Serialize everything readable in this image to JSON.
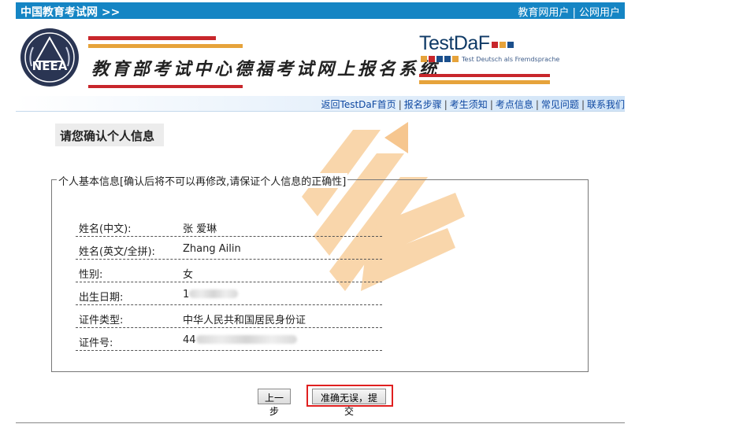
{
  "topbar": {
    "site_name": "中国教育考试网 >>",
    "users": [
      "教育网用户",
      "公网用户"
    ],
    "separator": " | ",
    "color": "#1585c4"
  },
  "header": {
    "logo_text": "NEEA",
    "system_title": "教育部考试中心德福考试网上报名系统",
    "brand": "TestDaF",
    "brand_tagline": "Test Deutsch als Fremdsprache",
    "brand_square_colors": [
      "#c8262b",
      "#e6a33b",
      "#1b4f8c",
      "#c8262b"
    ]
  },
  "nav": {
    "links": [
      "返回TestDaF首页",
      "报名步骤",
      "考生须知",
      "考点信息",
      "常见问题",
      "联系我们"
    ]
  },
  "page": {
    "title": "请您确认个人信息",
    "fieldset_legend": "个人基本信息[确认后将不可以再修改,请保证个人信息的正确性]"
  },
  "info": {
    "name_cn_label": "姓名(中文):",
    "name_cn_value": "张 爱琳",
    "name_en_label": "姓名(英文/全拼):",
    "name_en_value": "Zhang Ailin",
    "gender_label": "性别:",
    "gender_value": "女",
    "birth_label": "出生日期:",
    "birth_value_prefix": "1",
    "idtype_label": "证件类型:",
    "idtype_value": "中华人民共和国居民身份证",
    "idnum_label": "证件号:",
    "idnum_value_prefix": "44"
  },
  "buttons": {
    "prev": "上一步",
    "submit": "准确无误，提交"
  },
  "colors": {
    "highlight": "#e02020",
    "watermark": "#f7c98f",
    "link": "#0d47a1"
  }
}
